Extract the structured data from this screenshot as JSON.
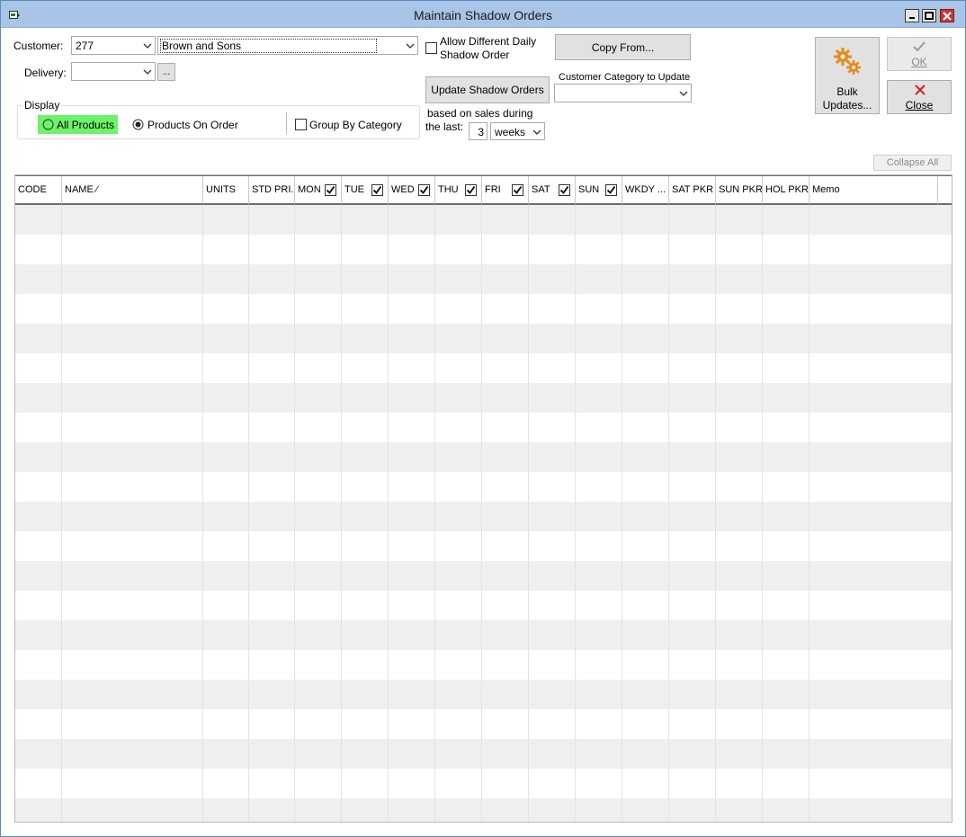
{
  "window": {
    "title": "Maintain Shadow Orders"
  },
  "form": {
    "customer_label": "Customer:",
    "customer_code": "277",
    "customer_name": "Brown and Sons",
    "delivery_label": "Delivery:",
    "delivery_value": "",
    "delivery_browse": "...",
    "allow_diff_label_1": "Allow Different Daily",
    "allow_diff_label_2": "Shadow Order",
    "copy_from": "Copy From...",
    "update_shadow_orders": "Update Shadow Orders",
    "customer_category_label": "Customer Category to Update",
    "customer_category_value": "",
    "based_on_1": "based on sales during",
    "based_on_2": "the last:",
    "weeks_count": "3",
    "weeks_unit": "weeks",
    "display_group": "Display",
    "all_products": "All Products",
    "products_on_order": "Products On Order",
    "group_by_category": "Group By Category",
    "bulk_updates_1": "Bulk",
    "bulk_updates_2": "Updates...",
    "ok": "OK",
    "close": "Close",
    "collapse_all": "Collapse All"
  },
  "grid": {
    "columns": [
      {
        "key": "code",
        "label": "CODE"
      },
      {
        "key": "name",
        "label": "NAME ⁄"
      },
      {
        "key": "units",
        "label": "UNITS"
      },
      {
        "key": "std",
        "label": "STD PRI..."
      },
      {
        "key": "mon",
        "label": "MON",
        "checked": true
      },
      {
        "key": "tue",
        "label": "TUE",
        "checked": true
      },
      {
        "key": "wed",
        "label": "WED",
        "checked": true
      },
      {
        "key": "thu",
        "label": "THU",
        "checked": true
      },
      {
        "key": "fri",
        "label": "FRI",
        "checked": true
      },
      {
        "key": "sat",
        "label": "SAT",
        "checked": true
      },
      {
        "key": "sun",
        "label": "SUN",
        "checked": true
      },
      {
        "key": "wkdy",
        "label": "WKDY ..."
      },
      {
        "key": "satpkr",
        "label": "SAT PKR"
      },
      {
        "key": "sunpkr",
        "label": "SUN PKR"
      },
      {
        "key": "holpkr",
        "label": "HOL PKR"
      },
      {
        "key": "memo",
        "label": "Memo"
      }
    ]
  },
  "colors": {
    "titlebar": "#a8c4e6",
    "highlight": "#6cf36a",
    "close_x": "#d42020",
    "gear": "#e88a1a"
  }
}
